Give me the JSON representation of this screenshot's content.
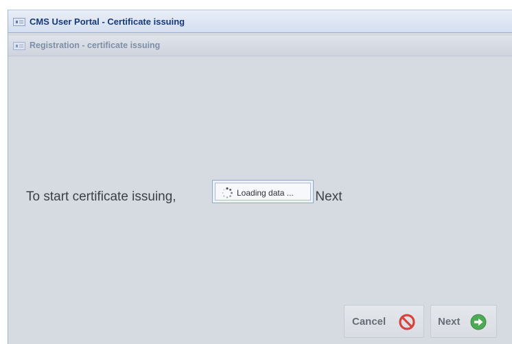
{
  "window": {
    "title": "CMS User Portal - Certificate issuing"
  },
  "panel": {
    "title": "Registration - certificate issuing"
  },
  "main": {
    "message_left": "To start certificate issuing, ",
    "message_right": "utton Next"
  },
  "loading": {
    "text": "Loading data ..."
  },
  "buttons": {
    "cancel_label": "Cancel",
    "next_label": "Next"
  },
  "colors": {
    "title_text": "#15397a",
    "cancel_icon": "#d9423c",
    "next_icon": "#4eaa55"
  },
  "icons": {
    "window": "window-icon",
    "panel": "panel-icon",
    "spinner": "spinner-icon",
    "cancel": "no-entry-icon",
    "next": "arrow-right-circle-icon"
  }
}
